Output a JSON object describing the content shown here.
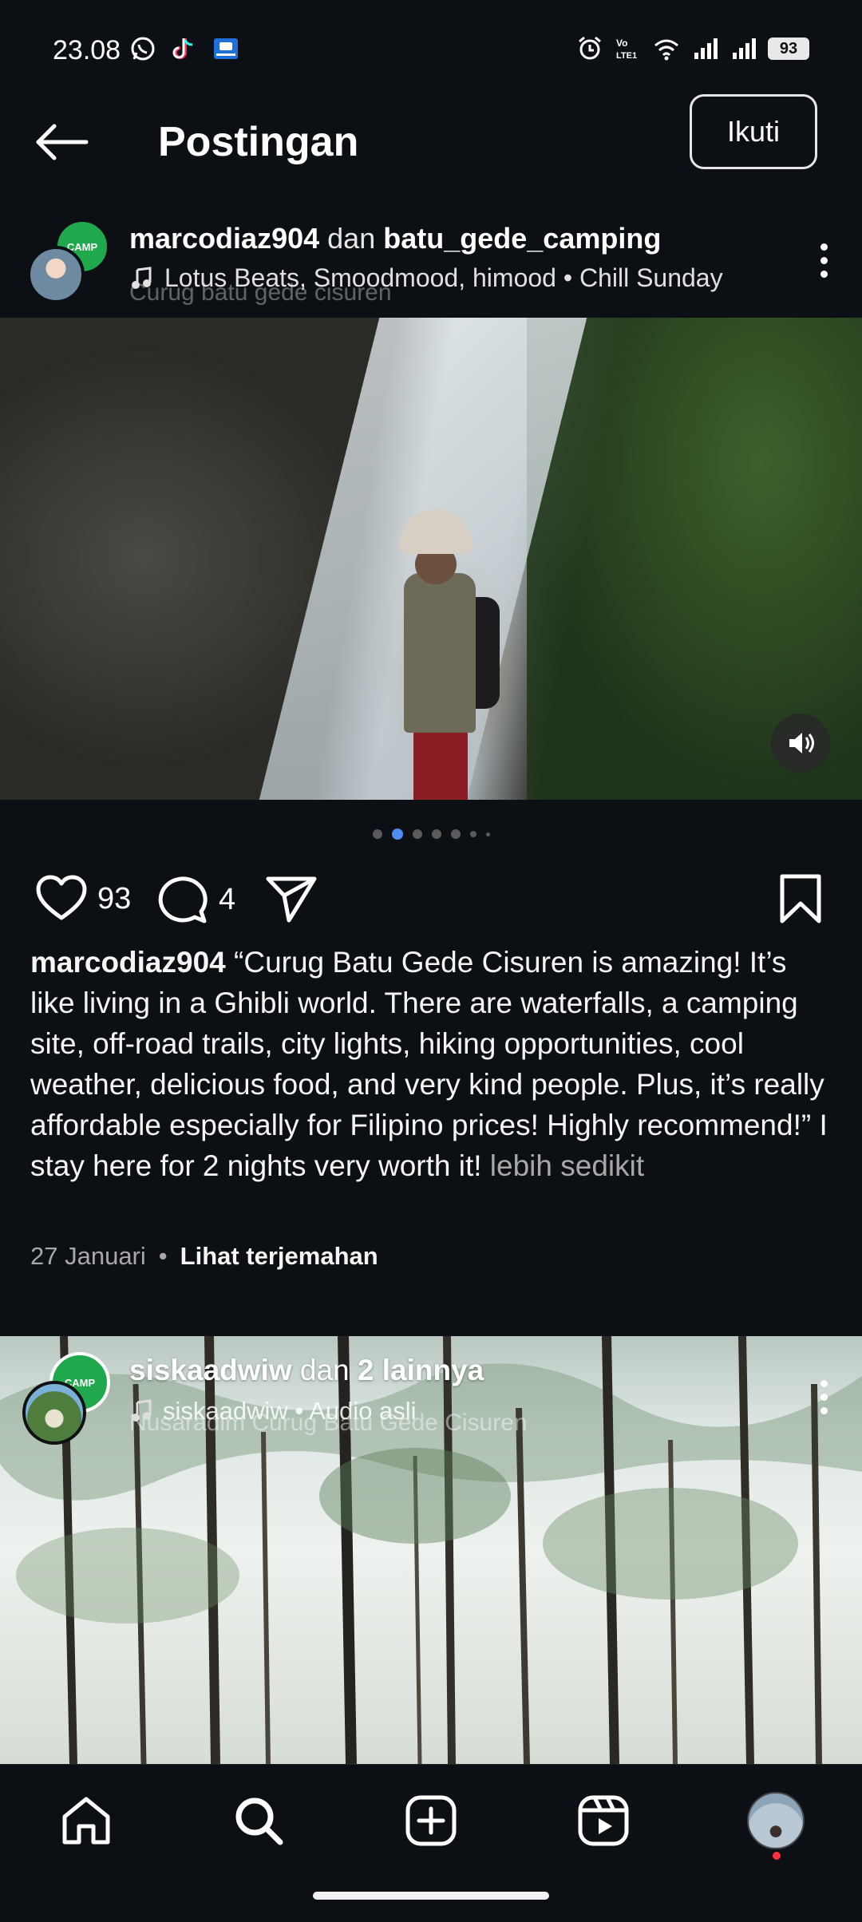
{
  "status_bar": {
    "time": "23.08",
    "battery": "93",
    "left_icons": [
      "whatsapp-icon",
      "tiktok-icon",
      "app-icon"
    ],
    "right_icons": [
      "alarm-icon",
      "volte-icon",
      "wifi-icon",
      "signal-icon",
      "signal-icon"
    ]
  },
  "header": {
    "title": "Postingan",
    "follow_label": "Ikuti"
  },
  "post1": {
    "user1": "marcodiaz904",
    "conjunction": "dan",
    "user2": "batu_gede_camping",
    "audio": "Lotus Beats, Smoodmood, himood • Chill Sunday",
    "location_ghost": "Curug batu gede cisuren",
    "logo_text": "CAMP",
    "likes": "93",
    "comments": "4",
    "caption_user": "marcodiaz904",
    "caption_text": "“Curug Batu Gede Cisuren is amazing! It’s like living in a Ghibli world. There are waterfalls, a camping site, off-road trails, city lights, hiking opportunities, cool weather, delicious food, and very kind people. Plus, it’s really affordable especially for Filipino prices! Highly recommend!” I stay here for 2 nights very worth it!",
    "less_label": "lebih sedikit",
    "date": "27 Januari",
    "separator": "•",
    "translate_label": "Lihat terjemahan"
  },
  "post2": {
    "user1": "siskaadwiw",
    "conjunction": "dan",
    "others": "2 lainnya",
    "audio": "siskaadwiw • Audio asli",
    "location_ghost": "Nusaradim Curug Batu Gede Cisuren",
    "logo_text": "CAMP"
  },
  "nav": [
    "home-icon",
    "search-icon",
    "create-icon",
    "reels-icon",
    "profile-avatar"
  ]
}
